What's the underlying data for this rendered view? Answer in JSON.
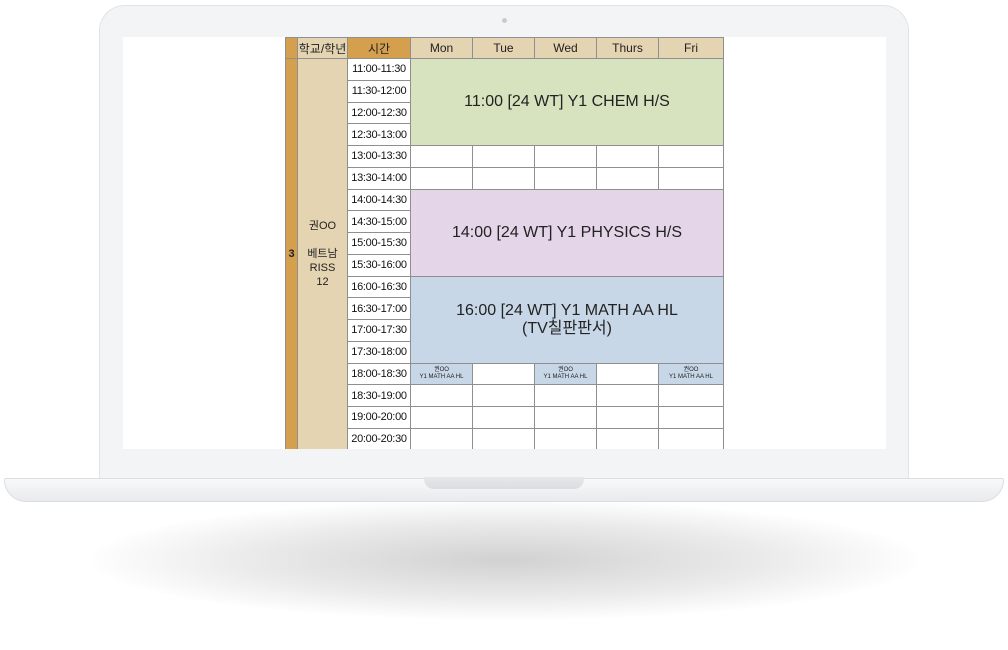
{
  "timetable": {
    "headers": [
      "학교/학년",
      "시간",
      "Mon",
      "Tue",
      "Wed",
      "Thurs",
      "Fri"
    ],
    "row_number": "3",
    "student": {
      "name": "권OO",
      "school": "베트남 RISS",
      "grade": "12"
    },
    "time_slots": [
      "11:00-11:30",
      "11:30-12:00",
      "12:00-12:30",
      "12:30-13:00",
      "13:00-13:30",
      "13:30-14:00",
      "14:00-14:30",
      "14:30-15:00",
      "15:00-15:30",
      "15:30-16:00",
      "16:00-16:30",
      "16:30-17:00",
      "17:00-17:30",
      "17:30-18:00",
      "18:00-18:30",
      "18:30-19:00",
      "19:00-20:00",
      "20:00-20:30"
    ],
    "blocks": {
      "chem": "11:00 [24 WT] Y1 CHEM H/S",
      "physics": "14:00 [24 WT] Y1 PHYSICS H/S",
      "math_line1": "16:00 [24 WT] Y1 MATH AA HL",
      "math_line2": "(TV칠판판서)"
    },
    "mini_sessions": {
      "mon": {
        "name": "권OO",
        "course": "Y1 MATH AA HL"
      },
      "wed": {
        "name": "권OO",
        "course": "Y1 MATH AA HL"
      },
      "fri": {
        "name": "권OO",
        "course": "Y1 MATH AA HL"
      }
    },
    "colors": {
      "chem": "#d7e3be",
      "physics": "#e5d5e8",
      "math": "#c8d7e7",
      "header": "#e4d4b2",
      "time_header": "#d4a04e"
    }
  }
}
